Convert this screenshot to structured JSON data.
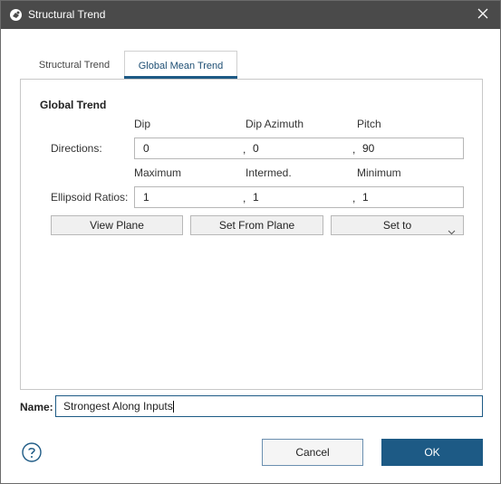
{
  "window": {
    "title": "Structural Trend",
    "title_icon": "leapfrog-app-icon",
    "close_icon": "close-icon"
  },
  "tabs": [
    {
      "label": "Structural Trend",
      "active": false
    },
    {
      "label": "Global Mean Trend",
      "active": true
    }
  ],
  "global_trend": {
    "section_title": "Global Trend",
    "directions": {
      "label": "Directions:",
      "headers": [
        "Dip",
        "Dip Azimuth",
        "Pitch"
      ],
      "values": [
        "0",
        "0",
        "90"
      ]
    },
    "ellipsoid": {
      "label": "Ellipsoid Ratios:",
      "headers": [
        "Maximum",
        "Intermed.",
        "Minimum"
      ],
      "values": [
        "1",
        "1",
        "1"
      ]
    },
    "separator": ",",
    "buttons": {
      "view_plane": "View Plane",
      "set_from_plane": "Set From Plane",
      "set_to": "Set to"
    }
  },
  "name": {
    "label": "Name:",
    "value": "Strongest Along Inputs"
  },
  "footer": {
    "help_icon": "help-icon",
    "cancel": "Cancel",
    "ok": "OK"
  },
  "colors": {
    "titlebar": "#4a4a4a",
    "accent": "#1d5a85",
    "active_tab_text": "#1d4e73"
  }
}
